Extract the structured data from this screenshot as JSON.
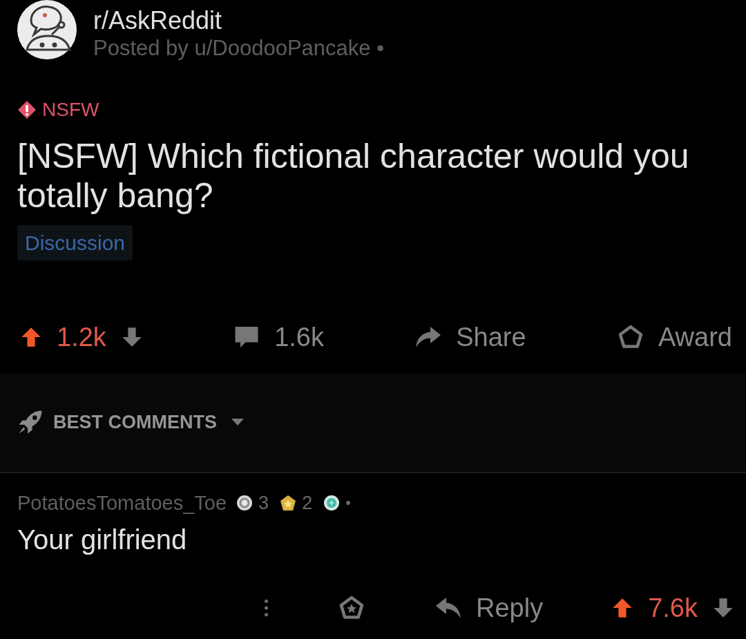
{
  "post": {
    "subreddit": "r/AskReddit",
    "posted_by": "Posted by u/DoodooPancake •",
    "tag": "NSFW",
    "title": "[NSFW] Which fictional character would you totally bang?",
    "flair": "Discussion",
    "votes": {
      "count": "1.2k",
      "upvoted": true
    },
    "actions": [
      {
        "kind": "comments",
        "label": "1.6k"
      },
      {
        "kind": "share",
        "label": "Share"
      },
      {
        "kind": "award",
        "label": "Award"
      }
    ]
  },
  "sort": {
    "label": "BEST COMMENTS"
  },
  "comments": [
    {
      "author": "PotatoesTomatoes_Toe",
      "awards": [
        {
          "kind": "silver",
          "count": "3"
        },
        {
          "kind": "gold",
          "count": "2"
        },
        {
          "kind": "platinum"
        }
      ],
      "separator": "•",
      "body": "Your girlfriend",
      "reply_label": "Reply",
      "votes": {
        "count": "7.6k",
        "upvoted": true
      }
    }
  ]
}
